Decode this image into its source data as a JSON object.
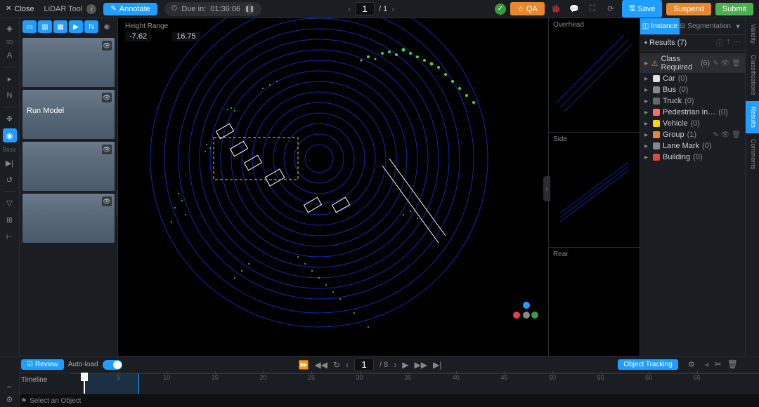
{
  "header": {
    "close": "Close",
    "tool_name": "LiDAR Tool",
    "annotate": "Annotate",
    "due_prefix": "Due in:",
    "due_time": "01:36:06",
    "page_current": "1",
    "page_total": "/ 1",
    "qa": "QA",
    "save": "Save",
    "suspend": "Suspend",
    "submit": "Submit"
  },
  "left_tools": {
    "label_3d": "3D",
    "label_basic": "Basic"
  },
  "cam_panel": {
    "run_model": "Run Model"
  },
  "viewport": {
    "height_range_label": "Height Range",
    "height_min": "-7.62",
    "height_max": "16.75"
  },
  "miniviews": {
    "overhead": "Overhead",
    "side": "Side",
    "rear": "Rear"
  },
  "tabs": {
    "instance": "Instance",
    "segmentation": "Segmentation"
  },
  "results": {
    "title": "Results (7)",
    "items": [
      {
        "label": "Class Required",
        "count": "(6)",
        "color": "#e8882e",
        "warn": true
      },
      {
        "label": "Car",
        "count": "(0)",
        "color": "#e0e0e0"
      },
      {
        "label": "Bus",
        "count": "(0)",
        "color": "#888"
      },
      {
        "label": "Truck",
        "count": "(0)",
        "color": "#666"
      },
      {
        "label": "Pedestrian in…",
        "count": "(0)",
        "color": "#ff6b6b"
      },
      {
        "label": "Vehicle",
        "count": "(0)",
        "color": "#ffd700"
      },
      {
        "label": "Group",
        "count": "(1)",
        "color": "#e8882e"
      },
      {
        "label": "Lane Mark",
        "count": "(0)",
        "color": "#888"
      },
      {
        "label": "Building",
        "count": "(0)",
        "color": "#d44"
      }
    ]
  },
  "side_tabs": {
    "validity": "Validity",
    "classifications": "Classifications",
    "results": "Results",
    "comments": "Comments"
  },
  "playbar": {
    "review": "Review",
    "autoload": "Auto-load",
    "frame_current": "1",
    "frame_total": "/ 8",
    "object_tracking": "Object Tracking"
  },
  "timeline": {
    "label": "Timeline",
    "ticks": [
      "5",
      "10",
      "15",
      "20",
      "25",
      "30",
      "35",
      "40",
      "45",
      "50",
      "55",
      "60",
      "65"
    ],
    "status": "Select an Object"
  }
}
